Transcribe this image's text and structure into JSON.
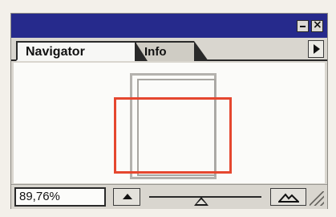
{
  "window": {
    "tabs": [
      {
        "label": "Navigator",
        "active": true
      },
      {
        "label": "Info",
        "active": false
      }
    ],
    "controls": {
      "minimize_icon": "minimize-icon",
      "close_icon": "close-icon",
      "menu_icon": "palette-menu-arrow-icon"
    }
  },
  "navigator": {
    "zoom_value": "89,76%",
    "view_box_color": "#e5472f",
    "slider_level_percent": 41
  },
  "icons": {
    "zoom_out": "small-mountain-icon",
    "zoom_in": "large-mountain-icon",
    "resize": "resize-grip-icon"
  },
  "colors": {
    "titlebar": "#262a8c",
    "panel": "#d9d6cf",
    "preview_bg": "#fbfbf9"
  }
}
